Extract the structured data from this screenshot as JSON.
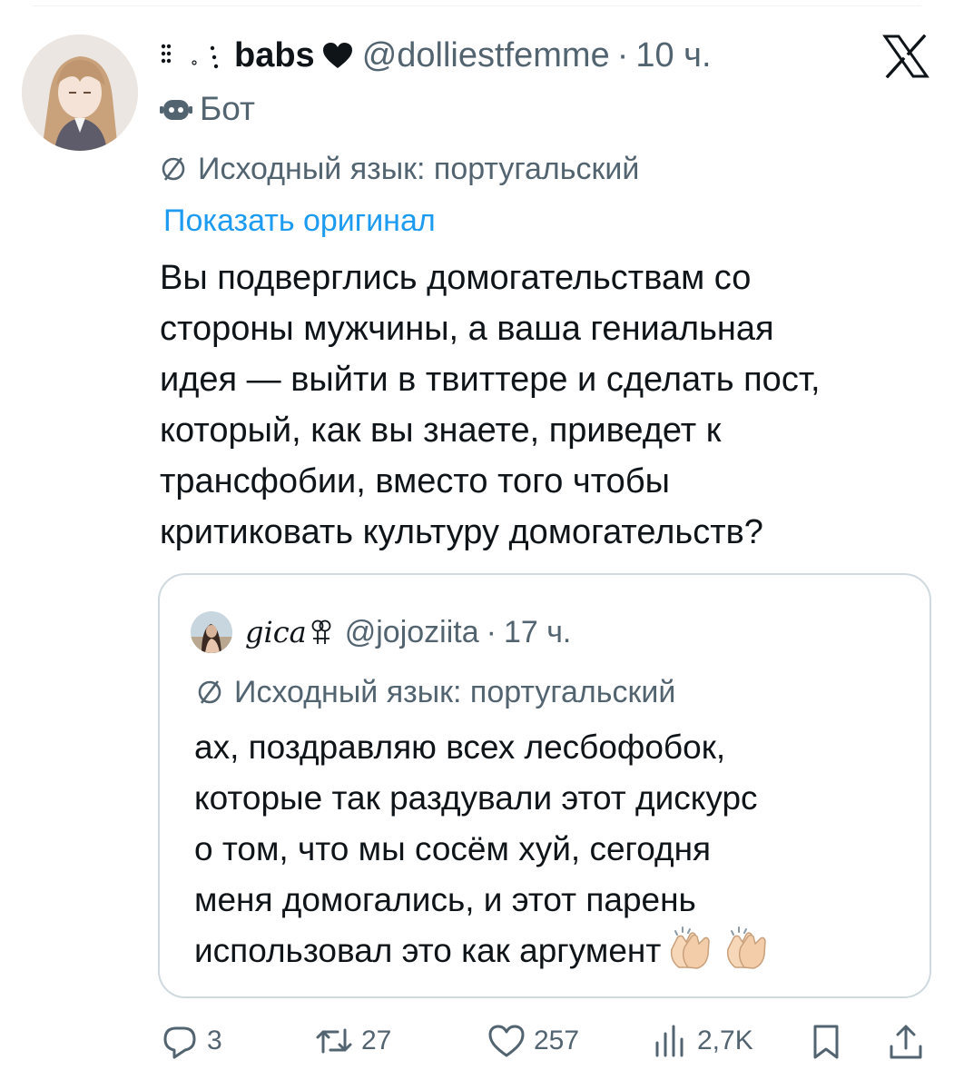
{
  "tweet": {
    "display_name": "babs",
    "handle": "@dolliestfemme",
    "separator": "·",
    "time": "10 ч.",
    "label": "Бот",
    "translation_note": "Исходный язык: португальский",
    "show_original": "Показать оригинал",
    "text": "Вы подверглись домогательствам со\nстороны мужчины, а ваша гениальная\nидея — выйти в твиттере и сделать пост,\nкоторый, как вы знаете, приведет к\nтрансфобии, вместо того чтобы\nкритиковать культуру домогательств?"
  },
  "quote": {
    "display_name": "gica",
    "handle": "@jojoziita",
    "separator": "·",
    "time": "17 ч.",
    "translation_note": "Исходный язык: португальский",
    "text": "ах, поздравляю всех лесбофобок,\nкоторые так раздували этот дискурс\nо том, что мы сосём хуй, сегодня\nменя домогались, и этот парень\nиспользовал это как аргумент"
  },
  "actions": {
    "replies": "3",
    "retweets": "27",
    "likes": "257",
    "views": "2,7K"
  },
  "icons": {
    "platform_logo": "x-logo-icon",
    "name_decoration": "dots-icon",
    "name_emoji": "heart-icon",
    "bot_label": "robot-icon",
    "translation": "translate-icon",
    "quote_name_emoji": "double-venus-icon",
    "quote_emoji": "clapping-hands-icon",
    "reply": "reply-icon",
    "retweet": "retweet-icon",
    "like": "like-icon",
    "views": "views-icon",
    "bookmark": "bookmark-icon",
    "share": "share-icon"
  },
  "colors": {
    "text": "#0f1419",
    "secondary": "#536471",
    "link": "#1d9bf0",
    "border": "#cfd9de"
  }
}
